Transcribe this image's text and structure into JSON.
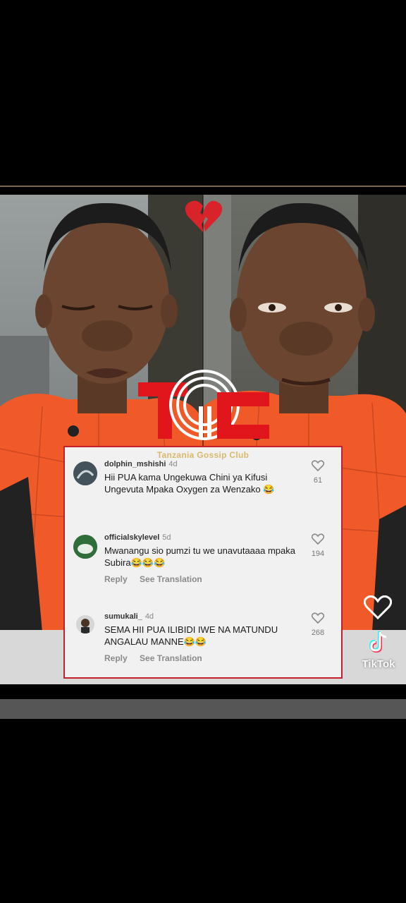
{
  "overlay": {
    "emoji": "💔",
    "brand_mark": "TGC",
    "club_name": "Tanzania Gossip Club"
  },
  "comments": [
    {
      "username": "dolphin_mshishi",
      "age": "4d",
      "text": "Hii PUA kama Ungekuwa Chini ya Kifusi Ungevuta Mpaka Oxygen za Wenzako 😂",
      "likes": "61"
    },
    {
      "username": "officialskylevel",
      "age": "5d",
      "text": "Mwanangu sio pumzi tu we unavutaaaa mpaka Subira😂😂😂",
      "reply_label": "Reply",
      "translate_label": "See Translation",
      "likes": "194"
    },
    {
      "username": "sumukali_",
      "age": "4d",
      "text": "SEMA HII PUA ILIBIDI IWE NA MATUNDU ANGALAU MANNE😂😂",
      "reply_label": "Reply",
      "translate_label": "See Translation",
      "likes": "268"
    }
  ],
  "tiktok": {
    "label": "TikTok"
  },
  "colors": {
    "accent_red": "#c0212a",
    "club_gold": "#d9b96a",
    "shirt_orange": "#f05a28"
  },
  "icons": [
    "broken-heart-icon",
    "heart-outline-icon",
    "tiktok-logo-icon"
  ]
}
